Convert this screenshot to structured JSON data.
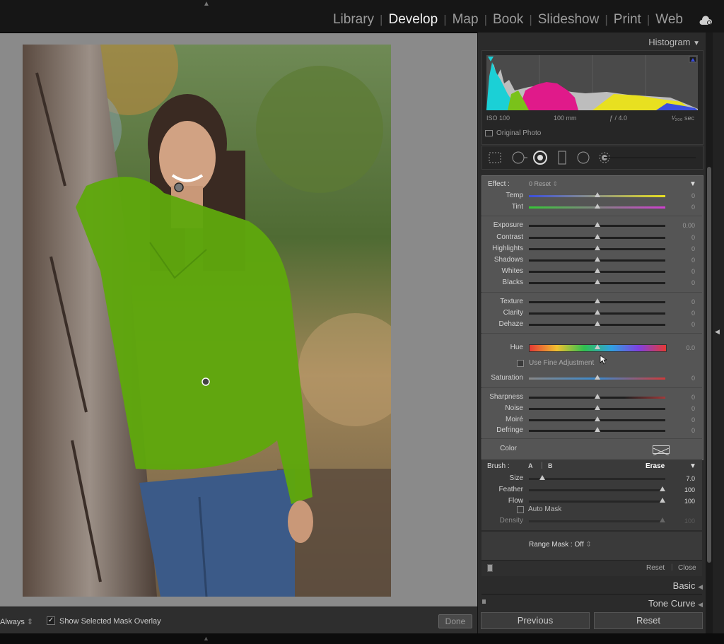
{
  "modules": [
    "Library",
    "Develop",
    "Map",
    "Book",
    "Slideshow",
    "Print",
    "Web"
  ],
  "active_module": "Develop",
  "histogram": {
    "title": "Histogram",
    "iso": "ISO 100",
    "focal": "100 mm",
    "aperture": "ƒ / 4.0",
    "shutter": "¹⁄₂₀₀ sec",
    "original_photo": "Original Photo"
  },
  "mask": {
    "effect_label": "Effect :",
    "effect_value": "0 Reset",
    "sliders": [
      {
        "label": "Temp",
        "value": "0",
        "level": 0.5
      },
      {
        "label": "Tint",
        "value": "0",
        "level": 0.5
      },
      {
        "label": "Exposure",
        "value": "0.00",
        "level": 0.5
      },
      {
        "label": "Contrast",
        "value": "0",
        "level": 0.5
      },
      {
        "label": "Highlights",
        "value": "0",
        "level": 0.5
      },
      {
        "label": "Shadows",
        "value": "0",
        "level": 0.5
      },
      {
        "label": "Whites",
        "value": "0",
        "level": 0.5
      },
      {
        "label": "Blacks",
        "value": "0",
        "level": 0.5
      },
      {
        "label": "Texture",
        "value": "0",
        "level": 0.5
      },
      {
        "label": "Clarity",
        "value": "0",
        "level": 0.5
      },
      {
        "label": "Dehaze",
        "value": "0",
        "level": 0.5
      },
      {
        "label": "Hue",
        "value": "0.0",
        "level": 0.5
      },
      {
        "label": "Saturation",
        "value": "0",
        "level": 0.5
      },
      {
        "label": "Sharpness",
        "value": "0",
        "level": 0.5
      },
      {
        "label": "Noise",
        "value": "0",
        "level": 0.5
      },
      {
        "label": "Moiré",
        "value": "0",
        "level": 0.5
      },
      {
        "label": "Defringe",
        "value": "0",
        "level": 0.5
      }
    ],
    "fine_adjustment": "Use Fine Adjustment",
    "color_label": "Color"
  },
  "brush": {
    "label": "Brush :",
    "tab_a": "A",
    "tab_b": "B",
    "erase": "Erase",
    "sliders": [
      {
        "label": "Size",
        "value": "7.0",
        "level": 0.1
      },
      {
        "label": "Feather",
        "value": "100",
        "level": 1.0
      },
      {
        "label": "Flow",
        "value": "100",
        "level": 1.0
      }
    ],
    "auto_mask": "Auto Mask",
    "density_label": "Density",
    "density_value": "100",
    "density_level": 1.0
  },
  "range_mask": "Range Mask : Off",
  "footer": {
    "reset": "Reset",
    "close": "Close"
  },
  "sections": {
    "basic": "Basic",
    "tone_curve": "Tone Curve"
  },
  "buttons": {
    "previous": "Previous",
    "reset": "Reset"
  },
  "toolbar": {
    "always": "Always",
    "overlay_label": "Show Selected Mask Overlay",
    "done": "Done"
  },
  "colors": {
    "mask_overlay": "#5fa80d",
    "panel_bg": "#555555"
  }
}
